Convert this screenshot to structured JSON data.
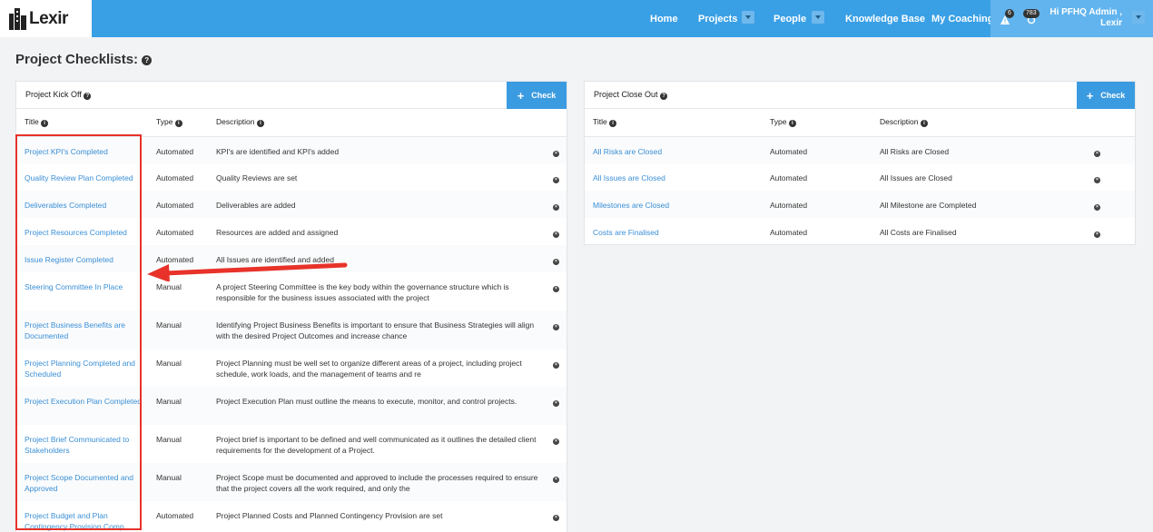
{
  "app": {
    "logo_text": "Lexir"
  },
  "nav": {
    "items": [
      {
        "label": "Home"
      },
      {
        "label": "Projects"
      },
      {
        "label": "People"
      },
      {
        "label": "Knowledge Base"
      },
      {
        "label": "My Coaching"
      }
    ],
    "alerts_count": "6",
    "sync_count": "783",
    "user_line1": "Hi PFHQ Admin ,",
    "user_line2": "Lexir"
  },
  "page": {
    "title": "Project Checklists:"
  },
  "kickoff": {
    "title": "Project Kick Off",
    "check_label": "Check",
    "headers": {
      "title": "Title",
      "type": "Type",
      "description": "Description"
    },
    "rows": [
      {
        "title": "Project KPI's Completed",
        "type": "Automated",
        "description": "KPI's are identified and KPI's added"
      },
      {
        "title": "Quality Review Plan Completed",
        "type": "Automated",
        "description": "Quality Reviews are set"
      },
      {
        "title": "Deliverables Completed",
        "type": "Automated",
        "description": "Deliverables are added"
      },
      {
        "title": "Project Resources Completed",
        "type": "Automated",
        "description": "Resources are added and assigned"
      },
      {
        "title": "Issue Register Completed",
        "type": "Automated",
        "description": "All Issues are identified and added"
      },
      {
        "title": "Steering Committee In Place",
        "type": "Manual",
        "description": "A project Steering Committee is the key body within the governance structure which is responsible for the business issues associated with the project"
      },
      {
        "title": "Project Business Benefits are Documented",
        "type": "Manual",
        "description": "Identifying Project Business Benefits is important to ensure that Business Strategies will align with the desired Project Outcomes and increase chance"
      },
      {
        "title": "Project Planning Completed and Scheduled",
        "type": "Manual",
        "description": "Project Planning must be well set to organize different areas of a project, including project schedule, work loads, and the management of teams and re"
      },
      {
        "title": "Project Execution Plan Completed",
        "type": "Manual",
        "description": "Project Execution Plan must outline the means to execute, monitor, and control projects."
      },
      {
        "title": "Project Brief Communicated to Stakeholders",
        "type": "Manual",
        "description": "Project brief is important to be defined and well communicated as it outlines the detailed client requirements for the development of a Project."
      },
      {
        "title": "Project Scope Documented and Approved",
        "type": "Manual",
        "description": "Project Scope must be documented and approved to include the processes required to ensure that the project covers all the work required, and only the"
      },
      {
        "title": "Project Budget and Plan Contingency Provision Comp",
        "type": "Automated",
        "description": "Project Planned Costs and Planned Contingency Provision are set"
      }
    ]
  },
  "closeout": {
    "title": "Project Close Out",
    "check_label": "Check",
    "headers": {
      "title": "Title",
      "type": "Type",
      "description": "Description"
    },
    "rows": [
      {
        "title": "All Risks are Closed",
        "type": "Automated",
        "description": "All Risks are Closed"
      },
      {
        "title": "All Issues are Closed",
        "type": "Automated",
        "description": "All Issues are Closed"
      },
      {
        "title": "Milestones are Closed",
        "type": "Automated",
        "description": "All Milestone are Completed"
      },
      {
        "title": "Costs are Finalised",
        "type": "Automated",
        "description": "All Costs are Finalised"
      }
    ]
  }
}
